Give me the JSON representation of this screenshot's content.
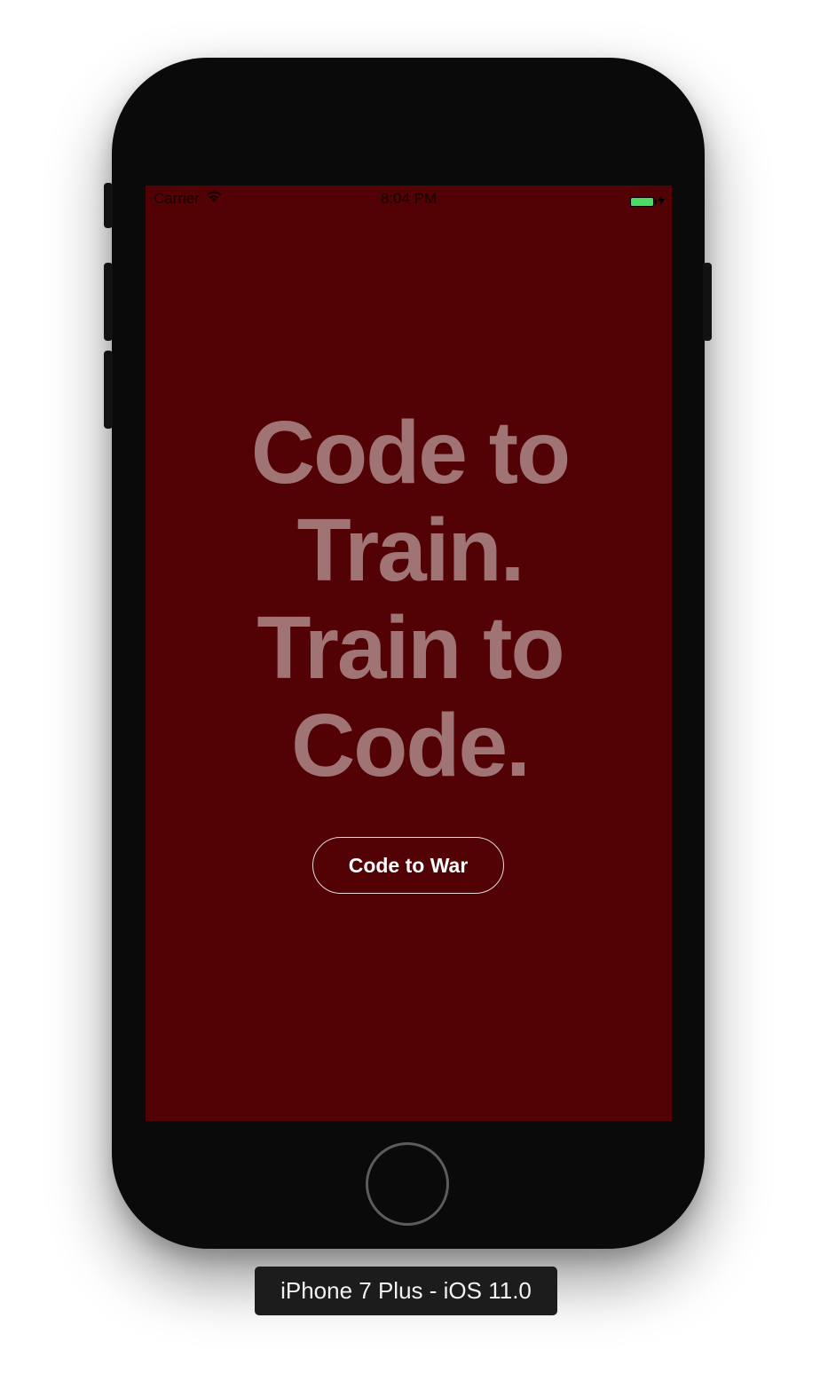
{
  "status_bar": {
    "carrier": "Carrier",
    "time": "8:04 PM",
    "icons": {
      "wifi": "wifi-icon",
      "battery": "battery-icon",
      "charging": "charging-bolt-icon"
    },
    "battery_level": 1.0
  },
  "screen": {
    "background_color": "#520105",
    "headline_lines": [
      "Code to",
      "Train.",
      "Train to",
      "Code."
    ],
    "button_label": "Code to War"
  },
  "device": {
    "label": "iPhone 7 Plus - iOS 11.0"
  },
  "colors": {
    "battery_fill": "#4cd964",
    "headline_text": "rgba(255,255,255,0.45)",
    "device_body": "#0a0a0a"
  }
}
